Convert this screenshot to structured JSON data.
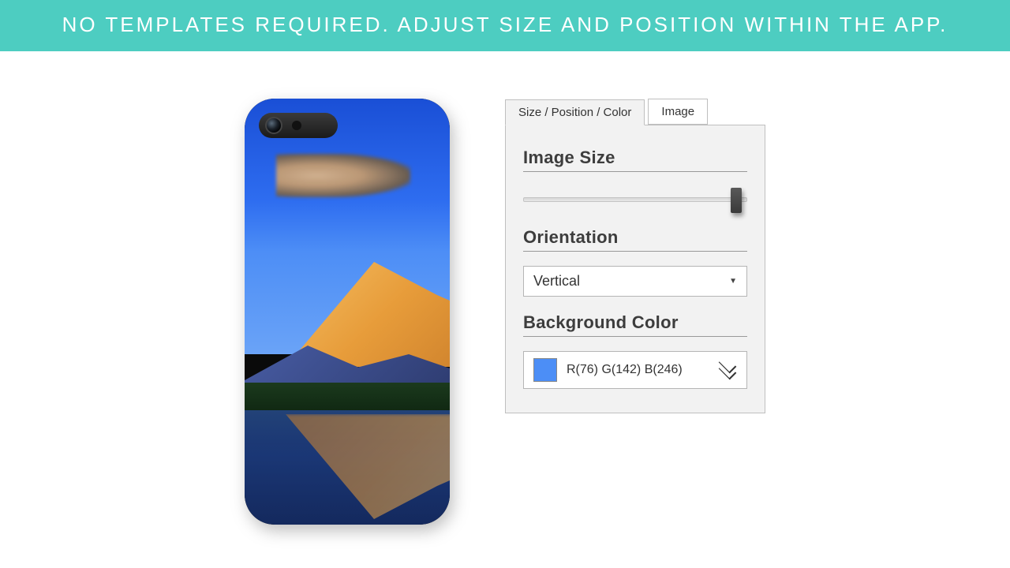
{
  "banner": {
    "text": "NO TEMPLATES REQUIRED. ADJUST SIZE AND POSITION WITHIN THE APP."
  },
  "tabs": {
    "size_position_color": "Size / Position / Color",
    "image": "Image"
  },
  "panel": {
    "image_size": {
      "label": "Image Size",
      "value_percent": 95
    },
    "orientation": {
      "label": "Orientation",
      "selected": "Vertical"
    },
    "background_color": {
      "label": "Background Color",
      "text": "R(76) G(142) B(246)",
      "hex": "#4c8ef6"
    }
  }
}
